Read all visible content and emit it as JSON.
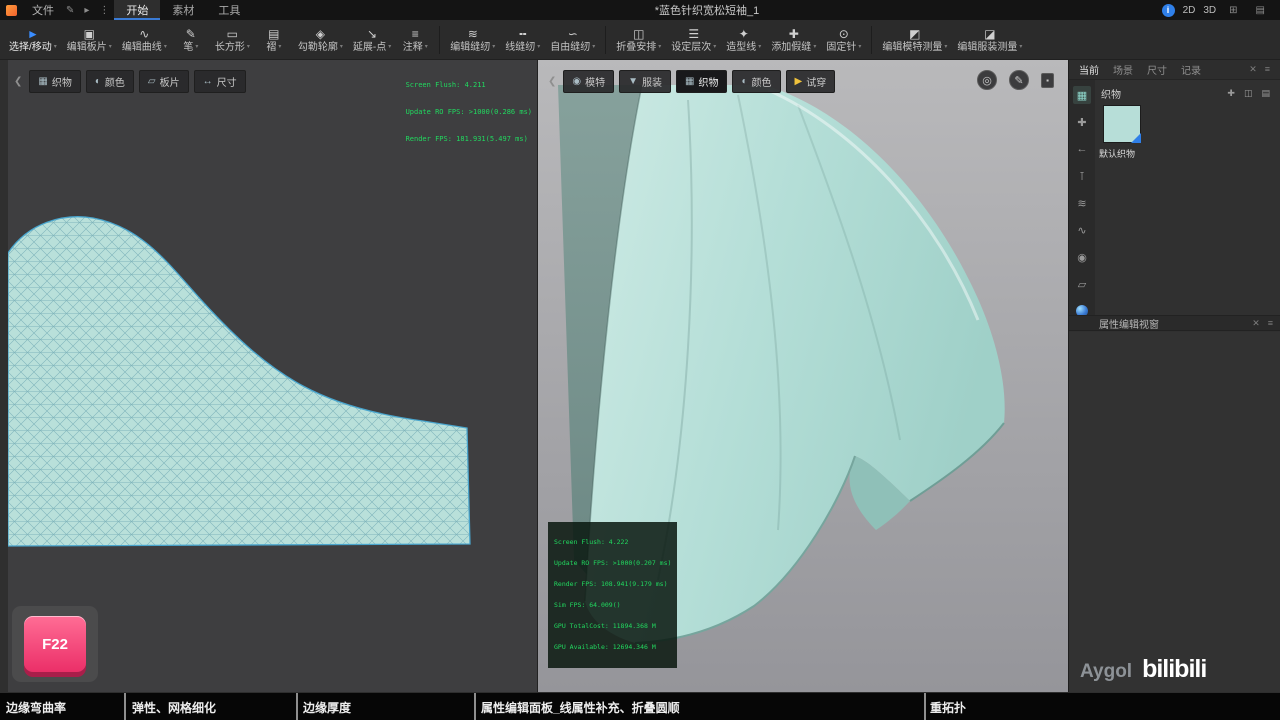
{
  "titlebar": {
    "menu_file": "文件",
    "icons": {
      "pen": "✎",
      "arrow": "▸",
      "dots": "⋮",
      "grid": "⊞",
      "panel": "▤",
      "info": "i"
    },
    "tabs": [
      {
        "label": "开始"
      },
      {
        "label": "素材"
      },
      {
        "label": "工具"
      }
    ],
    "title": "*蓝色针织宽松短袖_1",
    "mode_2d": "2D",
    "mode_3d": "3D"
  },
  "toolbar": {
    "caret": "▾",
    "items": [
      {
        "label": "选择/移动",
        "icon": "►"
      },
      {
        "label": "编辑板片",
        "icon": "▣"
      },
      {
        "label": "编辑曲线",
        "icon": "∿"
      },
      {
        "label": "笔",
        "icon": "✎"
      },
      {
        "label": "长方形",
        "icon": "▭"
      },
      {
        "label": "褶",
        "icon": "▤"
      },
      {
        "label": "勾勒轮廓",
        "icon": "◈"
      },
      {
        "label": "延展-点",
        "icon": "↘"
      },
      {
        "label": "注释",
        "icon": "≡"
      },
      {
        "label": "编辑缝纫",
        "icon": "≋"
      },
      {
        "label": "线缝纫",
        "icon": "╍"
      },
      {
        "label": "自由缝纫",
        "icon": "∽"
      },
      {
        "label": "折叠安排",
        "icon": "◫"
      },
      {
        "label": "设定层次",
        "icon": "☰"
      },
      {
        "label": "造型线",
        "icon": "✦"
      },
      {
        "label": "添加假缝",
        "icon": "✚"
      },
      {
        "label": "固定针",
        "icon": "⊙"
      },
      {
        "label": "编辑模特测量",
        "icon": "◩"
      },
      {
        "label": "编辑服装测量",
        "icon": "◪"
      }
    ]
  },
  "view2d": {
    "back": "❮",
    "tabs": [
      {
        "icon": "▦",
        "label": "织物"
      },
      {
        "icon": "◐",
        "label": "颜色"
      },
      {
        "icon": "▱",
        "label": "板片"
      },
      {
        "icon": "↔",
        "label": "尺寸"
      }
    ],
    "debug": [
      "Screen Flush: 4.211",
      "Update RO FPS: >1000(0.286 ms)",
      "Render FPS: 181.931(5.497 ms)"
    ],
    "hotkey": "F22",
    "fabric_color": "#b9e0da"
  },
  "view3d": {
    "back": "❮",
    "tabs": [
      {
        "icon": "◉",
        "label": "模特"
      },
      {
        "icon": "▼",
        "label": "服装"
      },
      {
        "icon": "▦",
        "label": "织物"
      },
      {
        "icon": "◐",
        "label": "颜色"
      },
      {
        "icon": "▶",
        "label": "试穿"
      }
    ],
    "circle_buttons": [
      {
        "icon": "◎"
      },
      {
        "icon": "✎"
      }
    ],
    "mini_button": "▪",
    "debug": [
      "Screen Flush: 4.222",
      "Update RO FPS: >1000(0.207 ms)",
      "Render FPS: 108.941(9.179 ms)",
      "Sim FPS: 64.009()",
      "GPU TotalCost: 11894.368 M",
      "GPU Available: 12694.346 M"
    ]
  },
  "sidebar": {
    "tabs": [
      {
        "label": "当前"
      },
      {
        "label": "场景"
      },
      {
        "label": "尺寸"
      },
      {
        "label": "记录"
      }
    ],
    "close_icon": "✕",
    "menu_icon": "≡",
    "fabric": {
      "title": "织物",
      "add_icon": "✚",
      "grid_icon": "◫",
      "list_icon": "▤",
      "swatch_label": "默认织物",
      "swatch_color": "#b7ded8",
      "swatch_style": "background:#b7ded8"
    },
    "strip": [
      {
        "glyph": "▦"
      },
      {
        "glyph": "✚"
      },
      {
        "glyph": "←"
      },
      {
        "glyph": "⊺"
      },
      {
        "glyph": "≋"
      },
      {
        "glyph": "∿"
      },
      {
        "glyph": "◉"
      },
      {
        "glyph": "▱"
      }
    ],
    "panel_title": "属性编辑视窗"
  },
  "chapters": [
    {
      "label": "边缘弯曲率"
    },
    {
      "label": "弹性、网格细化"
    },
    {
      "label": "边缘厚度"
    },
    {
      "label": "属性编辑面板_线属性补充、折叠圆顺"
    },
    {
      "label": "重拓扑"
    }
  ],
  "watermark": {
    "name": "Aygol",
    "logo": "bilibili"
  }
}
